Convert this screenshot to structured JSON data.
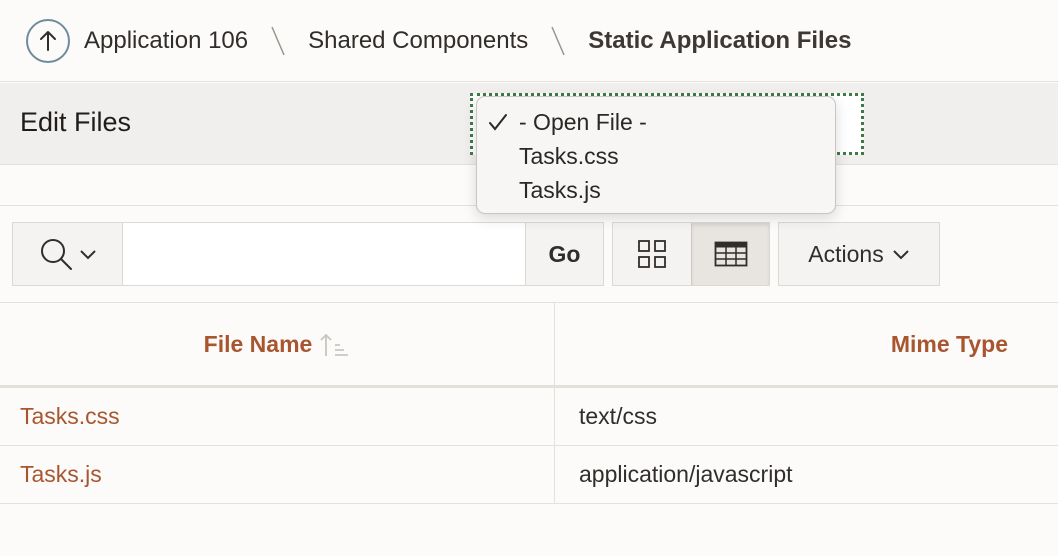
{
  "breadcrumb": {
    "items": [
      "Application 106",
      "Shared Components",
      "Static Application Files"
    ]
  },
  "edit": {
    "title": "Edit Files",
    "dropdown_options": [
      "- Open File -",
      "Tasks.css",
      "Tasks.js"
    ],
    "selected_option": "- Open File -"
  },
  "toolbar": {
    "search_placeholder": "",
    "go_label": "Go",
    "actions_label": "Actions"
  },
  "table": {
    "columns": [
      "File Name",
      "Mime Type"
    ],
    "rows": [
      [
        "Tasks.css",
        "text/css"
      ],
      [
        "Tasks.js",
        "application/javascript"
      ]
    ]
  },
  "icons": {
    "up": "arrow-up-icon",
    "search": "search-icon",
    "grid": "grid-view-icon",
    "report": "report-view-icon",
    "sort": "sort-ascending-icon"
  },
  "colors": {
    "link": "#a8562f",
    "focus": "#3f7a45"
  }
}
